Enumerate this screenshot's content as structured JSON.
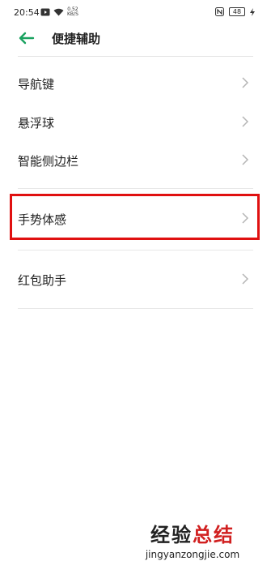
{
  "status_bar": {
    "time": "20:54",
    "net_speed_value": "0.52",
    "net_speed_unit": "KB/S",
    "battery": "48",
    "icons": [
      "media-icon",
      "wifi-icon",
      "nfc-icon",
      "charging-icon"
    ]
  },
  "header": {
    "title": "便捷辅助",
    "back_icon": "back-arrow-icon",
    "accent_color": "#1aa260"
  },
  "items": [
    {
      "label": "导航键"
    },
    {
      "label": "悬浮球"
    },
    {
      "label": "智能侧边栏"
    },
    {
      "label": "手势体感"
    },
    {
      "label": "红包助手"
    }
  ],
  "highlight_color": "#e01010",
  "watermark": {
    "text_left": "经验",
    "text_right": "总结",
    "url": "jingyanzongjie.com"
  }
}
